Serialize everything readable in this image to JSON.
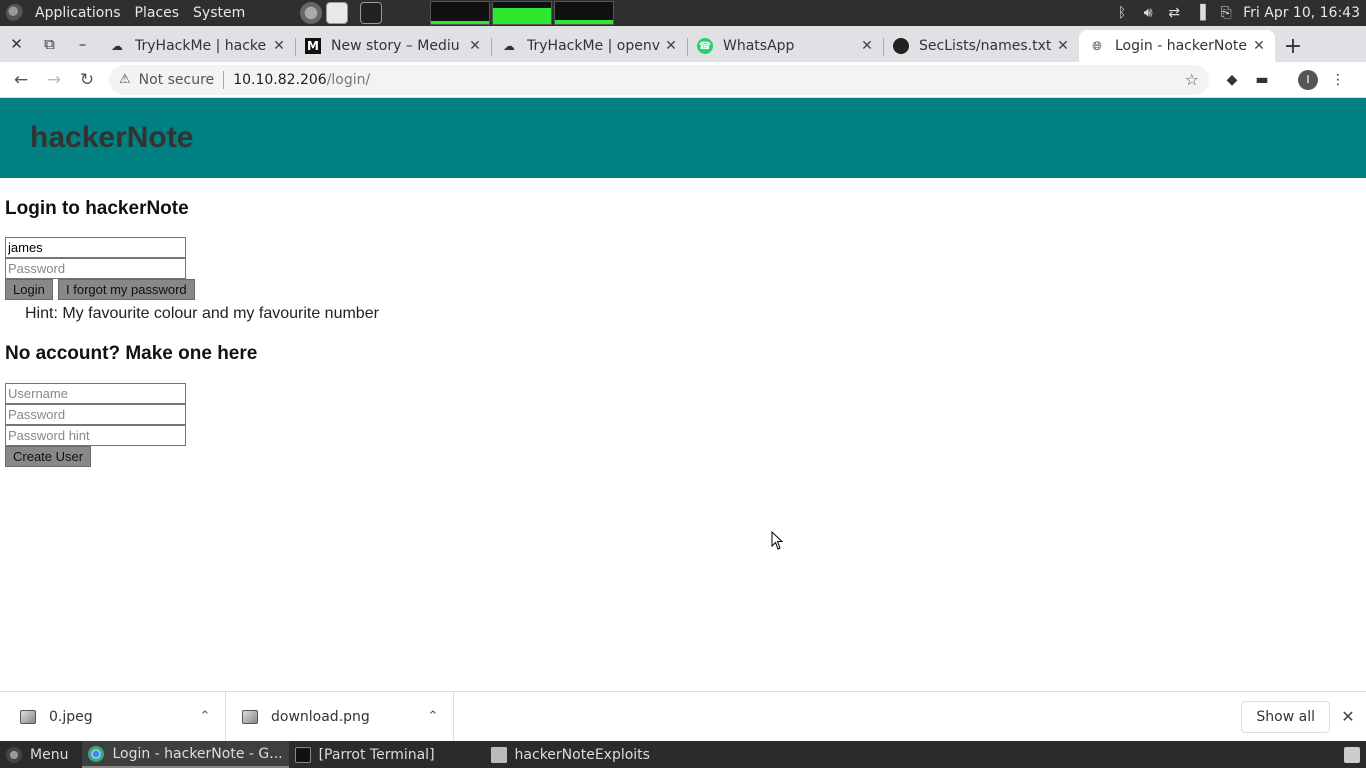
{
  "system_panel": {
    "menus": [
      "Applications",
      "Places",
      "System"
    ],
    "datetime": "Fri Apr 10, 16:43",
    "monitor_levels": [
      0.15,
      0.75,
      0.2
    ]
  },
  "tabs": [
    {
      "title": "TryHackMe | hacke",
      "icon": "cloud-icon"
    },
    {
      "title": "New story – Mediu",
      "icon": "medium-icon"
    },
    {
      "title": "TryHackMe | openv",
      "icon": "cloud-icon"
    },
    {
      "title": "WhatsApp",
      "icon": "whatsapp-icon"
    },
    {
      "title": "SecLists/names.txt",
      "icon": "github-icon"
    },
    {
      "title": "Login - hackerNote",
      "icon": "globe-icon",
      "active": true
    }
  ],
  "address_bar": {
    "security_label": "Not secure",
    "host": "10.10.82.206",
    "path": "/login/"
  },
  "profile_initial": "I",
  "site": {
    "title": "hackerNote",
    "login_heading": "Login to hackerNote",
    "username_value": "james",
    "password_placeholder": "Password",
    "login_button": "Login",
    "forgot_button": "I forgot my password",
    "hint_text": "Hint: My favourite colour and my favourite number",
    "signup_heading": "No account? Make one here",
    "signup_username_placeholder": "Username",
    "signup_password_placeholder": "Password",
    "signup_hint_placeholder": "Password hint",
    "create_button": "Create User"
  },
  "downloads": {
    "items": [
      "0.jpeg",
      "download.png"
    ],
    "show_all": "Show all"
  },
  "taskbar": {
    "menu": "Menu",
    "items": [
      "Login - hackerNote - G...",
      "[Parrot Terminal]",
      "hackerNoteExploits"
    ]
  },
  "colors": {
    "header_bg": "#008080",
    "button_bg": "#888888"
  }
}
